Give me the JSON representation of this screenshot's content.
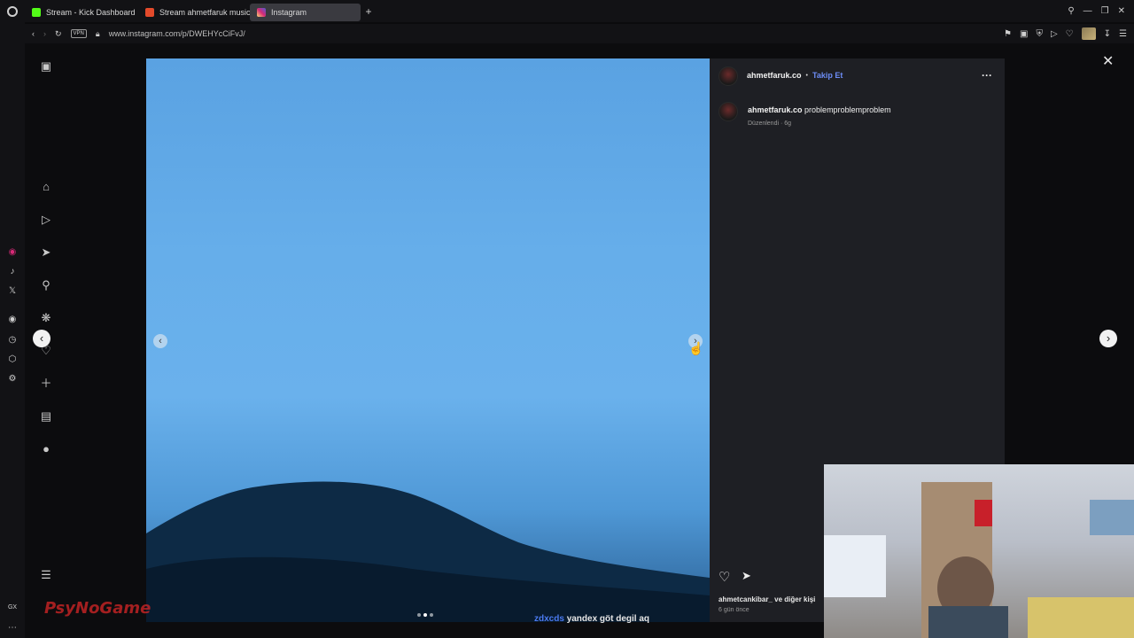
{
  "browser": {
    "tabs": [
      {
        "label": "Stream - Kick Dashboard",
        "favicon_color": "#53fc18"
      },
      {
        "label": "Stream ahmetfaruk music",
        "favicon_color": "#e34a2b"
      },
      {
        "label": "Instagram",
        "favicon_color": "#d62976"
      }
    ],
    "new_tab": "+",
    "vpn": "VPN",
    "url": "www.instagram.com/p/DWEHYcCiFvJ/"
  },
  "post": {
    "author": "ahmetfaruk.co",
    "separator": "•",
    "follow_label": "Takip Et",
    "more_label": "···",
    "caption_author": "ahmetfaruk.co",
    "caption_text": "problemproblemproblem",
    "caption_meta": "Düzenlendi · 6g",
    "likes_text": "ahmetcankibar_ ve diğer kişi",
    "time_ago": "6 gün önce",
    "carousel_total": 3,
    "carousel_index": 2
  },
  "overlay": {
    "chat_user": "zdxcds",
    "chat_message": "yandex göt degil aq",
    "logo_text": "PsyNoGame"
  },
  "colors": {
    "sky": "#64acea",
    "panel": "#1e1f24",
    "follow": "#6c8cf5"
  }
}
